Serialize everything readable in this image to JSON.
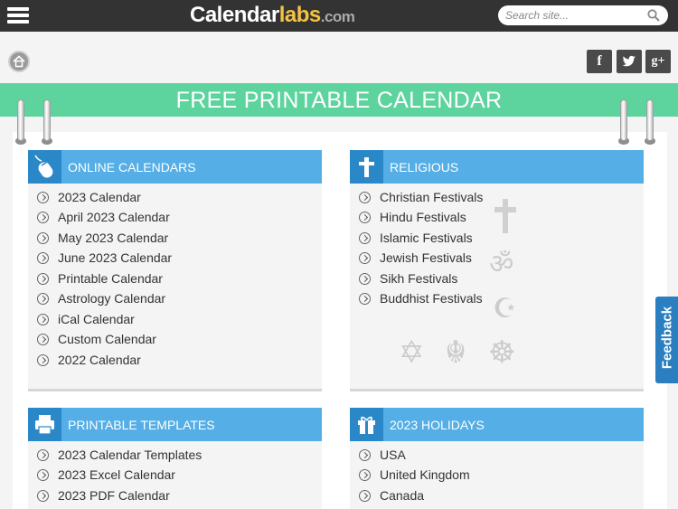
{
  "header": {
    "logo_part1": "Calendar",
    "logo_part2": "labs",
    "logo_part3": ".com",
    "search_placeholder": "Search site..."
  },
  "social": {
    "facebook": "f",
    "twitter": "t",
    "googleplus": "g+"
  },
  "banner": {
    "title": "FREE PRINTABLE CALENDAR"
  },
  "cards": {
    "online": {
      "title": "ONLINE CALENDARS",
      "icon": "mouse-icon",
      "items": [
        "2023 Calendar",
        "April 2023 Calendar",
        "May 2023 Calendar",
        "June 2023 Calendar",
        "Printable Calendar",
        "Astrology Calendar",
        "iCal Calendar",
        "Custom Calendar",
        "2022 Calendar"
      ]
    },
    "religious": {
      "title": "RELIGIOUS",
      "icon": "cross-icon",
      "items": [
        "Christian Festivals",
        "Hindu Festivals",
        "Islamic Festivals",
        "Jewish Festivals",
        "Sikh Festivals",
        "Buddhist Festivals"
      ]
    },
    "templates": {
      "title": "PRINTABLE TEMPLATES",
      "icon": "printer-icon",
      "items": [
        "2023 Calendar Templates",
        "2023 Excel Calendar",
        "2023 PDF Calendar"
      ]
    },
    "holidays": {
      "title": "2023 HOLIDAYS",
      "icon": "gift-icon",
      "items": [
        "USA",
        "United Kingdom",
        "Canada"
      ]
    }
  },
  "feedback": {
    "label": "Feedback"
  },
  "colors": {
    "topbar": "#333333",
    "banner": "#5dd39e",
    "card_header": "#55aee5",
    "card_icon_box": "#2b88c8",
    "feedback": "#2b7fc0"
  }
}
